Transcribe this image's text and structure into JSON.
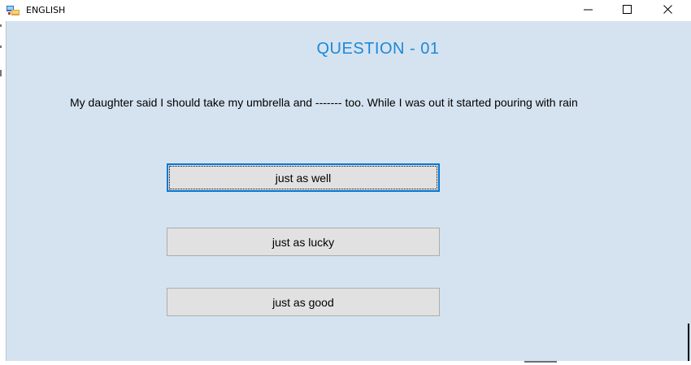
{
  "window": {
    "title": "ENGLISH",
    "controls": {
      "minimize": "minimize-icon",
      "maximize": "maximize-icon",
      "close": "close-icon"
    }
  },
  "quiz": {
    "question_heading": "QUESTION - 01",
    "question_text": "My daughter said I should take my umbrella and ------- too. While I was out it started pouring with rain",
    "options": [
      {
        "label": "just as well",
        "focused": true
      },
      {
        "label": "just as lucky",
        "focused": false
      },
      {
        "label": "just as good",
        "focused": false
      }
    ]
  },
  "colors": {
    "client_background": "#d5e3f0",
    "heading": "#1e88d8",
    "button_face": "#e1e1e1",
    "focus_border": "#0078d7"
  }
}
